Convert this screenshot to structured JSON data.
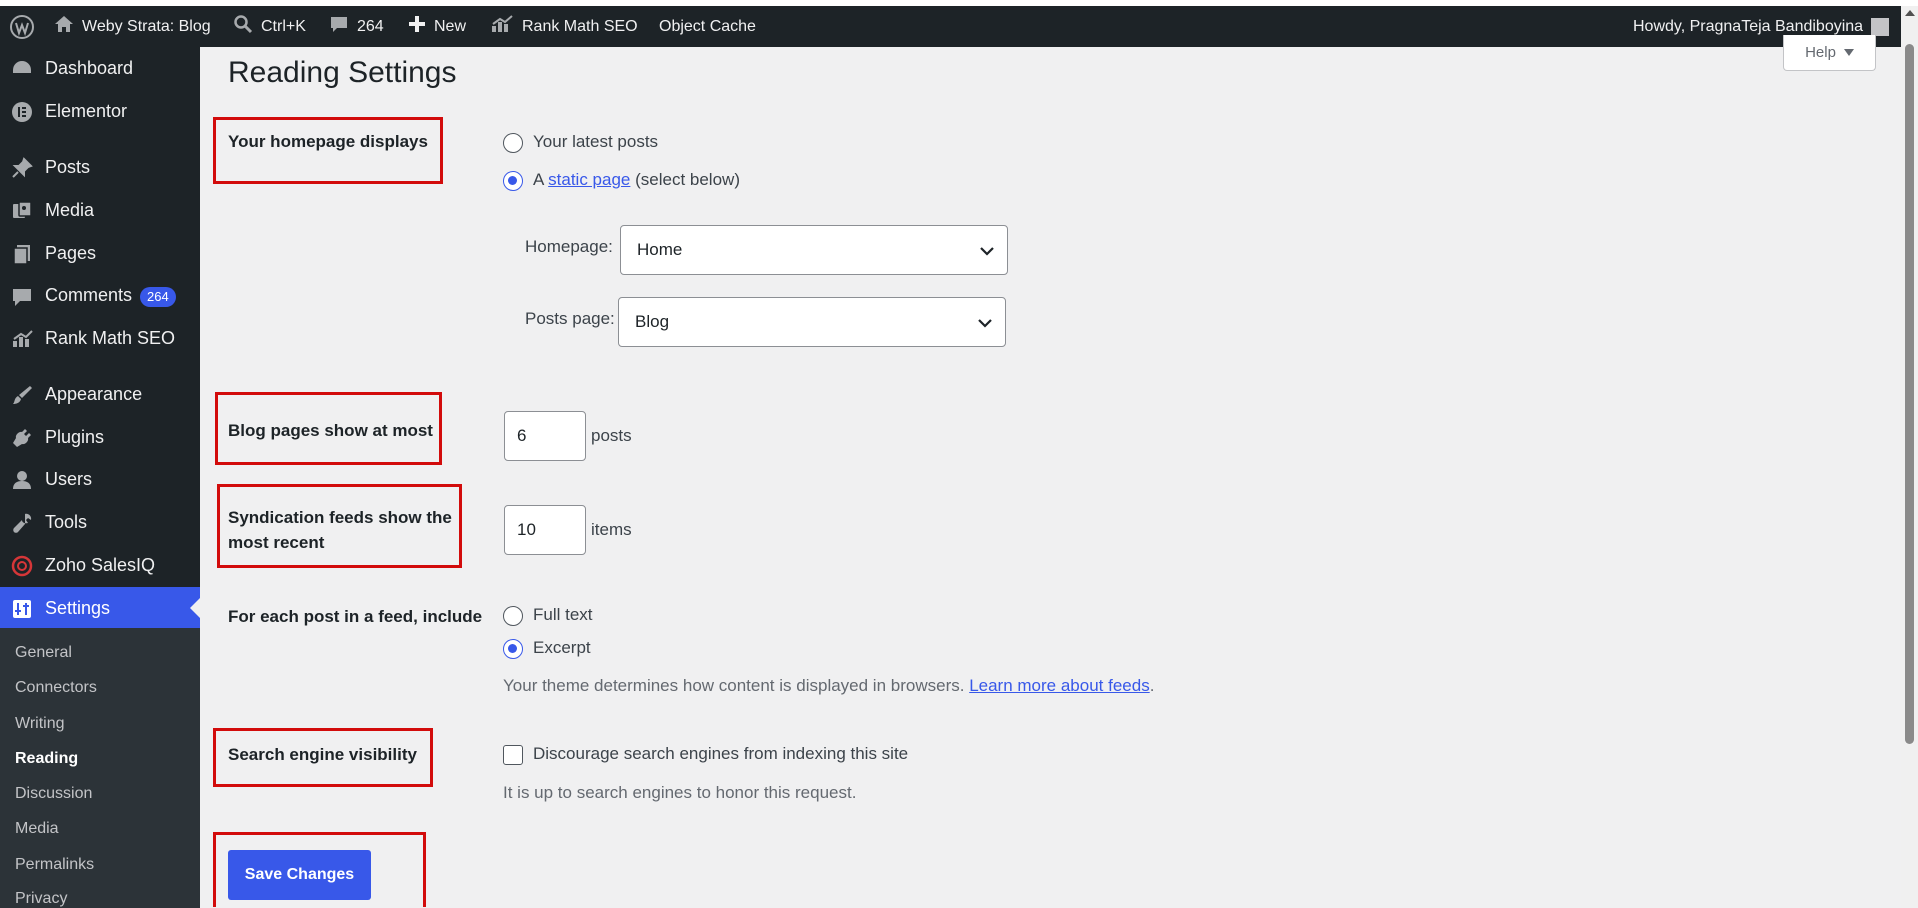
{
  "admin_bar": {
    "site_name": "Weby Strata: Blog",
    "search_shortcut": "Ctrl+K",
    "comments_count": "264",
    "new_label": "New",
    "rank_math_label": "Rank Math SEO",
    "object_cache_label": "Object Cache",
    "howdy": "Howdy, PragnaTeja Bandiboyina"
  },
  "sidebar": {
    "items": [
      {
        "label": "Dashboard",
        "icon": "dashboard-icon"
      },
      {
        "label": "Elementor",
        "icon": "elementor-icon"
      },
      {
        "label": "Posts",
        "icon": "pushpin-icon"
      },
      {
        "label": "Media",
        "icon": "media-icon"
      },
      {
        "label": "Pages",
        "icon": "pages-icon"
      },
      {
        "label": "Comments",
        "icon": "comment-icon",
        "badge": "264"
      },
      {
        "label": "Rank Math SEO",
        "icon": "chart-icon"
      },
      {
        "label": "Appearance",
        "icon": "brush-icon"
      },
      {
        "label": "Plugins",
        "icon": "plug-icon"
      },
      {
        "label": "Users",
        "icon": "user-icon"
      },
      {
        "label": "Tools",
        "icon": "wrench-icon"
      },
      {
        "label": "Zoho SalesIQ",
        "icon": "zoho-icon"
      },
      {
        "label": "Settings",
        "icon": "settings-icon"
      }
    ],
    "submenu": [
      "General",
      "Connectors",
      "Writing",
      "Reading",
      "Discussion",
      "Media",
      "Permalinks",
      "Privacy"
    ]
  },
  "page": {
    "title": "Reading Settings",
    "help_label": "Help"
  },
  "homepage": {
    "label": "Your homepage displays",
    "option_latest": "Your latest posts",
    "option_static_prefix": "A",
    "option_static_link": "static page",
    "option_static_suffix": "(select below)",
    "homepage_label": "Homepage:",
    "homepage_value": "Home",
    "posts_page_label": "Posts page:",
    "posts_page_value": "Blog"
  },
  "blog_pages": {
    "label": "Blog pages show at most",
    "value": "6",
    "unit": "posts"
  },
  "syndication": {
    "label_line1": "Syndication feeds show the",
    "label_line2": "most recent",
    "value": "10",
    "unit": "items"
  },
  "feed_content": {
    "label": "For each post in a feed, include",
    "option_full": "Full text",
    "option_excerpt": "Excerpt",
    "desc_prefix": "Your theme determines how content is displayed in browsers.",
    "desc_link": "Learn more about feeds",
    "desc_suffix": "."
  },
  "search_visibility": {
    "label": "Search engine visibility",
    "checkbox_label": "Discourage search engines from indexing this site",
    "desc": "It is up to search engines to honor this request."
  },
  "save_label": "Save Changes",
  "colors": {
    "accent": "#3858e9",
    "highlight_box": "#d20b0b",
    "admin_bar": "#1d2327"
  }
}
